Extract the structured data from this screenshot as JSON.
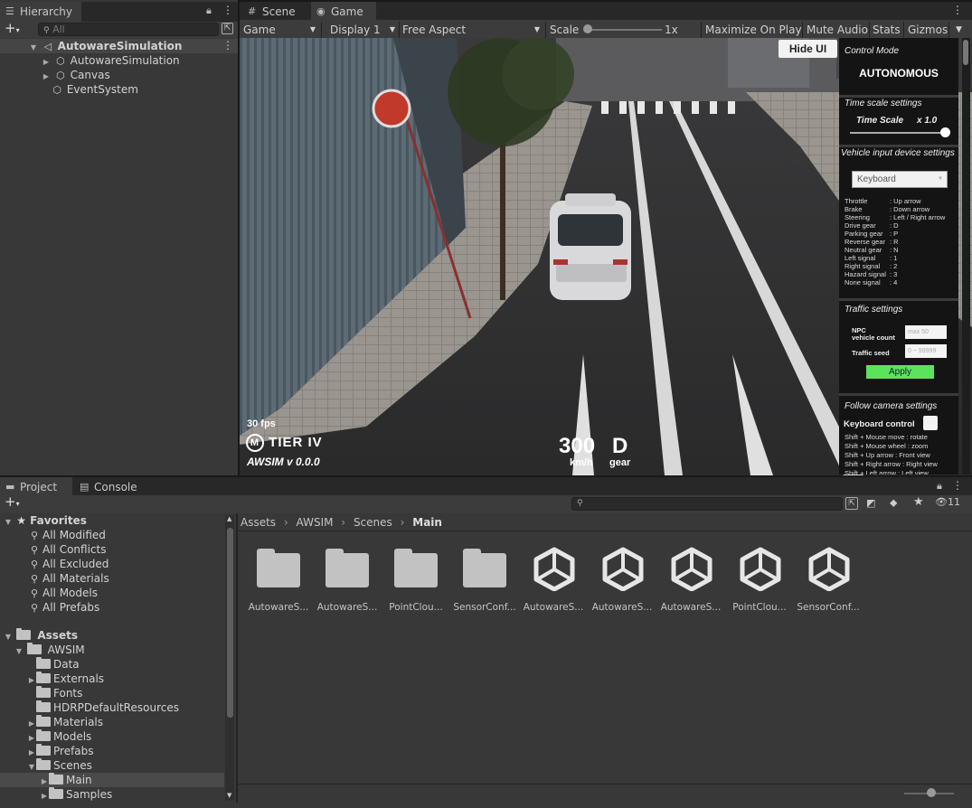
{
  "hierarchy": {
    "tab_label": "Hierarchy",
    "search_placeholder": "All",
    "root": "AutowareSimulation",
    "children": [
      "AutowareSimulation",
      "Canvas",
      "EventSystem"
    ]
  },
  "scene_tabs": {
    "scene": "Scene",
    "game": "Game"
  },
  "game_toolbar": {
    "mode": "Game",
    "display": "Display 1",
    "aspect": "Free Aspect",
    "scale_label": "Scale",
    "scale_value": "1x",
    "maximize": "Maximize On Play",
    "mute": "Mute Audio",
    "stats": "Stats",
    "gizmos": "Gizmos"
  },
  "hud": {
    "fps": "30 fps",
    "brand": "TIER IV",
    "version": "AWSIM  v 0.0.0",
    "speed": "300",
    "speed_unit": "km/h",
    "gear": "D",
    "gear_label": "gear",
    "hide_ui": "Hide UI"
  },
  "control_panel": {
    "control_mode_title": "Control Mode",
    "control_mode_value": "AUTONOMOUS",
    "time_scale_title": "Time scale settings",
    "time_scale_label": "Time Scale",
    "time_scale_value": "x 1.0",
    "time_scale_level": 1.0,
    "vehicle_input_title": "Vehicle input device settings",
    "input_device": "Keyboard",
    "keymap": [
      [
        "Throttle",
        ": Up arrow"
      ],
      [
        "Brake",
        ": Down arrow"
      ],
      [
        "Steering",
        ": Left / Right arrow"
      ],
      [
        "Drive gear",
        ": D"
      ],
      [
        "Parking gear",
        ": P"
      ],
      [
        "Reverse gear",
        ": R"
      ],
      [
        "Neutral gear",
        ": N"
      ],
      [
        "Left signal",
        ": 1"
      ],
      [
        "Right signal",
        ": 2"
      ],
      [
        "Hazard signal",
        ": 3"
      ],
      [
        "None signal",
        ": 4"
      ]
    ],
    "traffic_title": "Traffic settings",
    "npc_label_1": "NPC",
    "npc_label_2": "vehicle count",
    "npc_placeholder": "max 50",
    "seed_label": "Traffic seed",
    "seed_placeholder": "0 ~ 99999",
    "apply": "Apply",
    "follow_title": "Follow camera settings",
    "keyboard_control": "Keyboard control",
    "follow_help": [
      "Shift + Mouse move : rotate",
      "Shift + Mouse wheel : zoom",
      "Shift + Up arrow : Front view",
      "Shift + Right arrow : Right view",
      "Shift + Left arrow : Left view"
    ]
  },
  "bottom_tabs": {
    "project": "Project",
    "console": "Console"
  },
  "visibility_count": "11",
  "favorites": {
    "title": "Favorites",
    "items": [
      "All Modified",
      "All Conflicts",
      "All Excluded",
      "All Materials",
      "All Models",
      "All Prefabs"
    ]
  },
  "assets_tree": {
    "root": "Assets",
    "awsim": "AWSIM",
    "items": [
      "Data",
      "Externals",
      "Fonts",
      "HDRPDefaultResources",
      "Materials",
      "Models",
      "Prefabs",
      "Scenes"
    ],
    "scenes_children": [
      "Main",
      "Samples"
    ]
  },
  "breadcrumb": [
    "Assets",
    "AWSIM",
    "Scenes",
    "Main"
  ],
  "assets": [
    {
      "label": "AutowareS...",
      "kind": "folder-icon"
    },
    {
      "label": "AutowareS...",
      "kind": "folder-icon"
    },
    {
      "label": "PointClou...",
      "kind": "folder-icon"
    },
    {
      "label": "SensorConf...",
      "kind": "folder-icon"
    },
    {
      "label": "AutowareS...",
      "kind": "unity-scene-icon"
    },
    {
      "label": "AutowareS...",
      "kind": "unity-scene-icon"
    },
    {
      "label": "AutowareS...",
      "kind": "unity-scene-icon"
    },
    {
      "label": "PointClou...",
      "kind": "unity-scene-icon"
    },
    {
      "label": "SensorConf...",
      "kind": "unity-scene-icon"
    }
  ]
}
